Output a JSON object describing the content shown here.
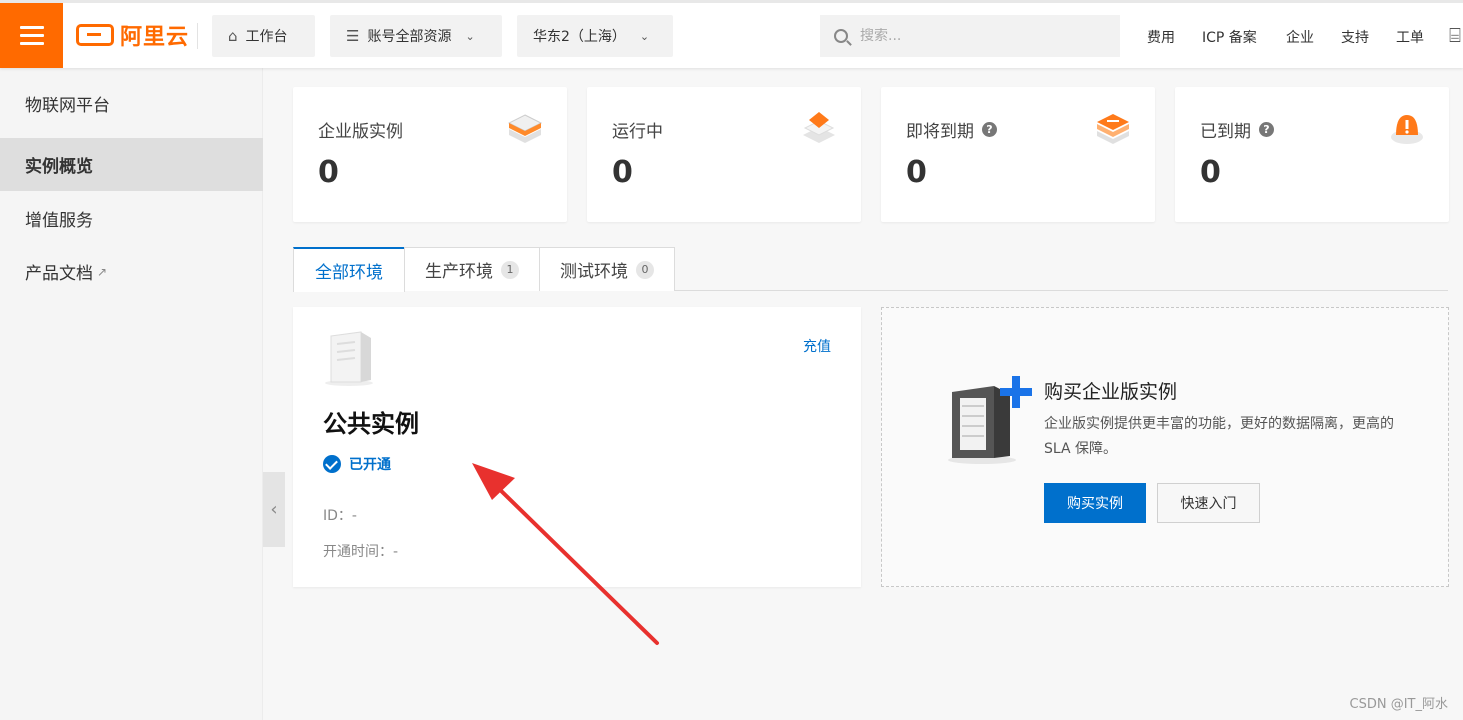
{
  "topbar": {
    "logo_text": "阿里云",
    "workbench": "工作台",
    "account_resources": "账号全部资源",
    "region": "华东2（上海）",
    "search_placeholder": "搜索...",
    "links": [
      "费用",
      "ICP 备案",
      "企业",
      "支持",
      "工单"
    ],
    "brand_color": "#ff6a00"
  },
  "sidebar": {
    "title": "物联网平台",
    "items": [
      {
        "label": "实例概览",
        "active": true
      },
      {
        "label": "增值服务",
        "active": false
      },
      {
        "label": "产品文档",
        "active": false,
        "external": true
      }
    ]
  },
  "stats": [
    {
      "label": "企业版实例",
      "value": "0",
      "help": false,
      "icon": "stack-layers-icon"
    },
    {
      "label": "运行中",
      "value": "0",
      "help": false,
      "icon": "diamond-stack-icon"
    },
    {
      "label": "即将到期",
      "value": "0",
      "help": true,
      "icon": "stack-clock-icon"
    },
    {
      "label": "已到期",
      "value": "0",
      "help": true,
      "icon": "alert-bell-icon"
    }
  ],
  "tabs": [
    {
      "label": "全部环境",
      "count": null,
      "active": true
    },
    {
      "label": "生产环境",
      "count": "1",
      "active": false
    },
    {
      "label": "测试环境",
      "count": "0",
      "active": false
    }
  ],
  "public_instance": {
    "recharge": "充值",
    "title": "公共实例",
    "status": "已开通",
    "id_line": "ID：-",
    "open_time_line": "开通时间：-"
  },
  "buy_card": {
    "title": "购买企业版实例",
    "description": "企业版实例提供更丰富的功能，更好的数据隔离，更高的 SLA 保障。",
    "buy_button": "购买实例",
    "quickstart_button": "快速入门"
  },
  "watermark": "CSDN @IT_阿水",
  "accent_color": "#0070cc",
  "annotation_color": "#e8312e"
}
